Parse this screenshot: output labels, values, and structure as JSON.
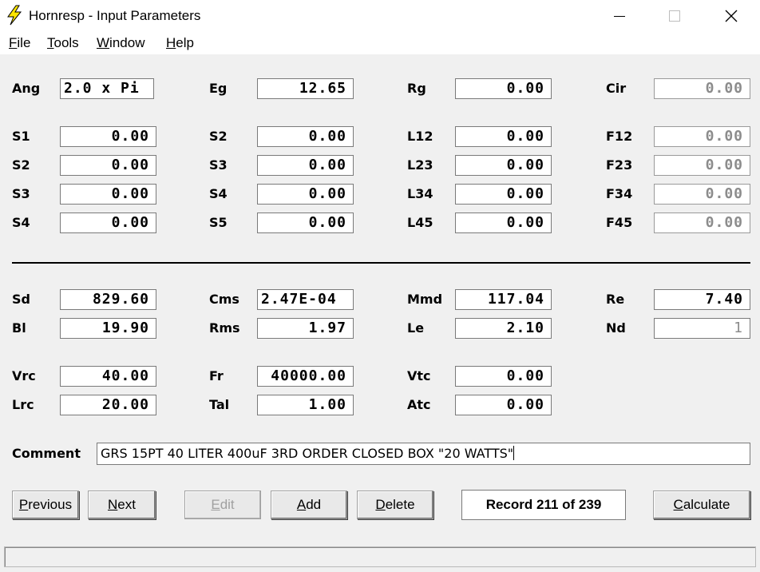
{
  "window": {
    "title": "Hornresp - Input Parameters",
    "icon": "lightning-icon",
    "controls": [
      "minimize",
      "maximize",
      "close"
    ]
  },
  "menu": [
    {
      "label": "File",
      "mnemonic": "F",
      "rest": "ile"
    },
    {
      "label": "Tools",
      "mnemonic": "T",
      "rest": "ools"
    },
    {
      "label": "Window",
      "mnemonic": "W",
      "rest": "indow"
    },
    {
      "label": "Help",
      "mnemonic": "H",
      "rest": "elp"
    }
  ],
  "params": {
    "ang": {
      "label": "Ang",
      "value": "2.0 x Pi"
    },
    "eg": {
      "label": "Eg",
      "value": "12.65"
    },
    "rg": {
      "label": "Rg",
      "value": "0.00"
    },
    "cir": {
      "label": "Cir",
      "value": "0.00"
    },
    "s1": {
      "label": "S1",
      "value": "0.00"
    },
    "s2a": {
      "label": "S2",
      "value": "0.00"
    },
    "s2b": {
      "label": "S2",
      "value": "0.00"
    },
    "s3a": {
      "label": "S3",
      "value": "0.00"
    },
    "s3b": {
      "label": "S3",
      "value": "0.00"
    },
    "s4a": {
      "label": "S4",
      "value": "0.00"
    },
    "s4b": {
      "label": "S4",
      "value": "0.00"
    },
    "s5": {
      "label": "S5",
      "value": "0.00"
    },
    "l12": {
      "label": "L12",
      "value": "0.00"
    },
    "l23": {
      "label": "L23",
      "value": "0.00"
    },
    "l34": {
      "label": "L34",
      "value": "0.00"
    },
    "l45": {
      "label": "L45",
      "value": "0.00"
    },
    "f12": {
      "label": "F12",
      "value": "0.00"
    },
    "f23": {
      "label": "F23",
      "value": "0.00"
    },
    "f34": {
      "label": "F34",
      "value": "0.00"
    },
    "f45": {
      "label": "F45",
      "value": "0.00"
    },
    "sd": {
      "label": "Sd",
      "value": "829.60"
    },
    "cms": {
      "label": "Cms",
      "value": "2.47E-04"
    },
    "mmd": {
      "label": "Mmd",
      "value": "117.04"
    },
    "re": {
      "label": "Re",
      "value": "7.40"
    },
    "bl": {
      "label": "Bl",
      "value": "19.90"
    },
    "rms": {
      "label": "Rms",
      "value": "1.97"
    },
    "le": {
      "label": "Le",
      "value": "2.10"
    },
    "nd": {
      "label": "Nd",
      "value": "1"
    },
    "vrc": {
      "label": "Vrc",
      "value": "40.00"
    },
    "fr": {
      "label": "Fr",
      "value": "40000.00"
    },
    "vtc": {
      "label": "Vtc",
      "value": "0.00"
    },
    "lrc": {
      "label": "Lrc",
      "value": "20.00"
    },
    "tal": {
      "label": "Tal",
      "value": "1.00"
    },
    "atc": {
      "label": "Atc",
      "value": "0.00"
    }
  },
  "comment": {
    "label": "Comment",
    "value": "GRS 15PT  40 LITER 400uF 3RD ORDER CLOSED BOX \"20 WATTS\""
  },
  "buttons": {
    "previous": {
      "mnemonic": "P",
      "rest": "revious"
    },
    "next": {
      "mnemonic": "N",
      "rest": "ext"
    },
    "edit": {
      "mnemonic": "E",
      "rest": "dit"
    },
    "add": {
      "mnemonic": "A",
      "rest": "dd"
    },
    "delete": {
      "mnemonic": "D",
      "rest": "elete"
    },
    "calculate": {
      "mnemonic": "C",
      "rest": "alculate"
    }
  },
  "record": "Record 211 of 239",
  "status": ""
}
